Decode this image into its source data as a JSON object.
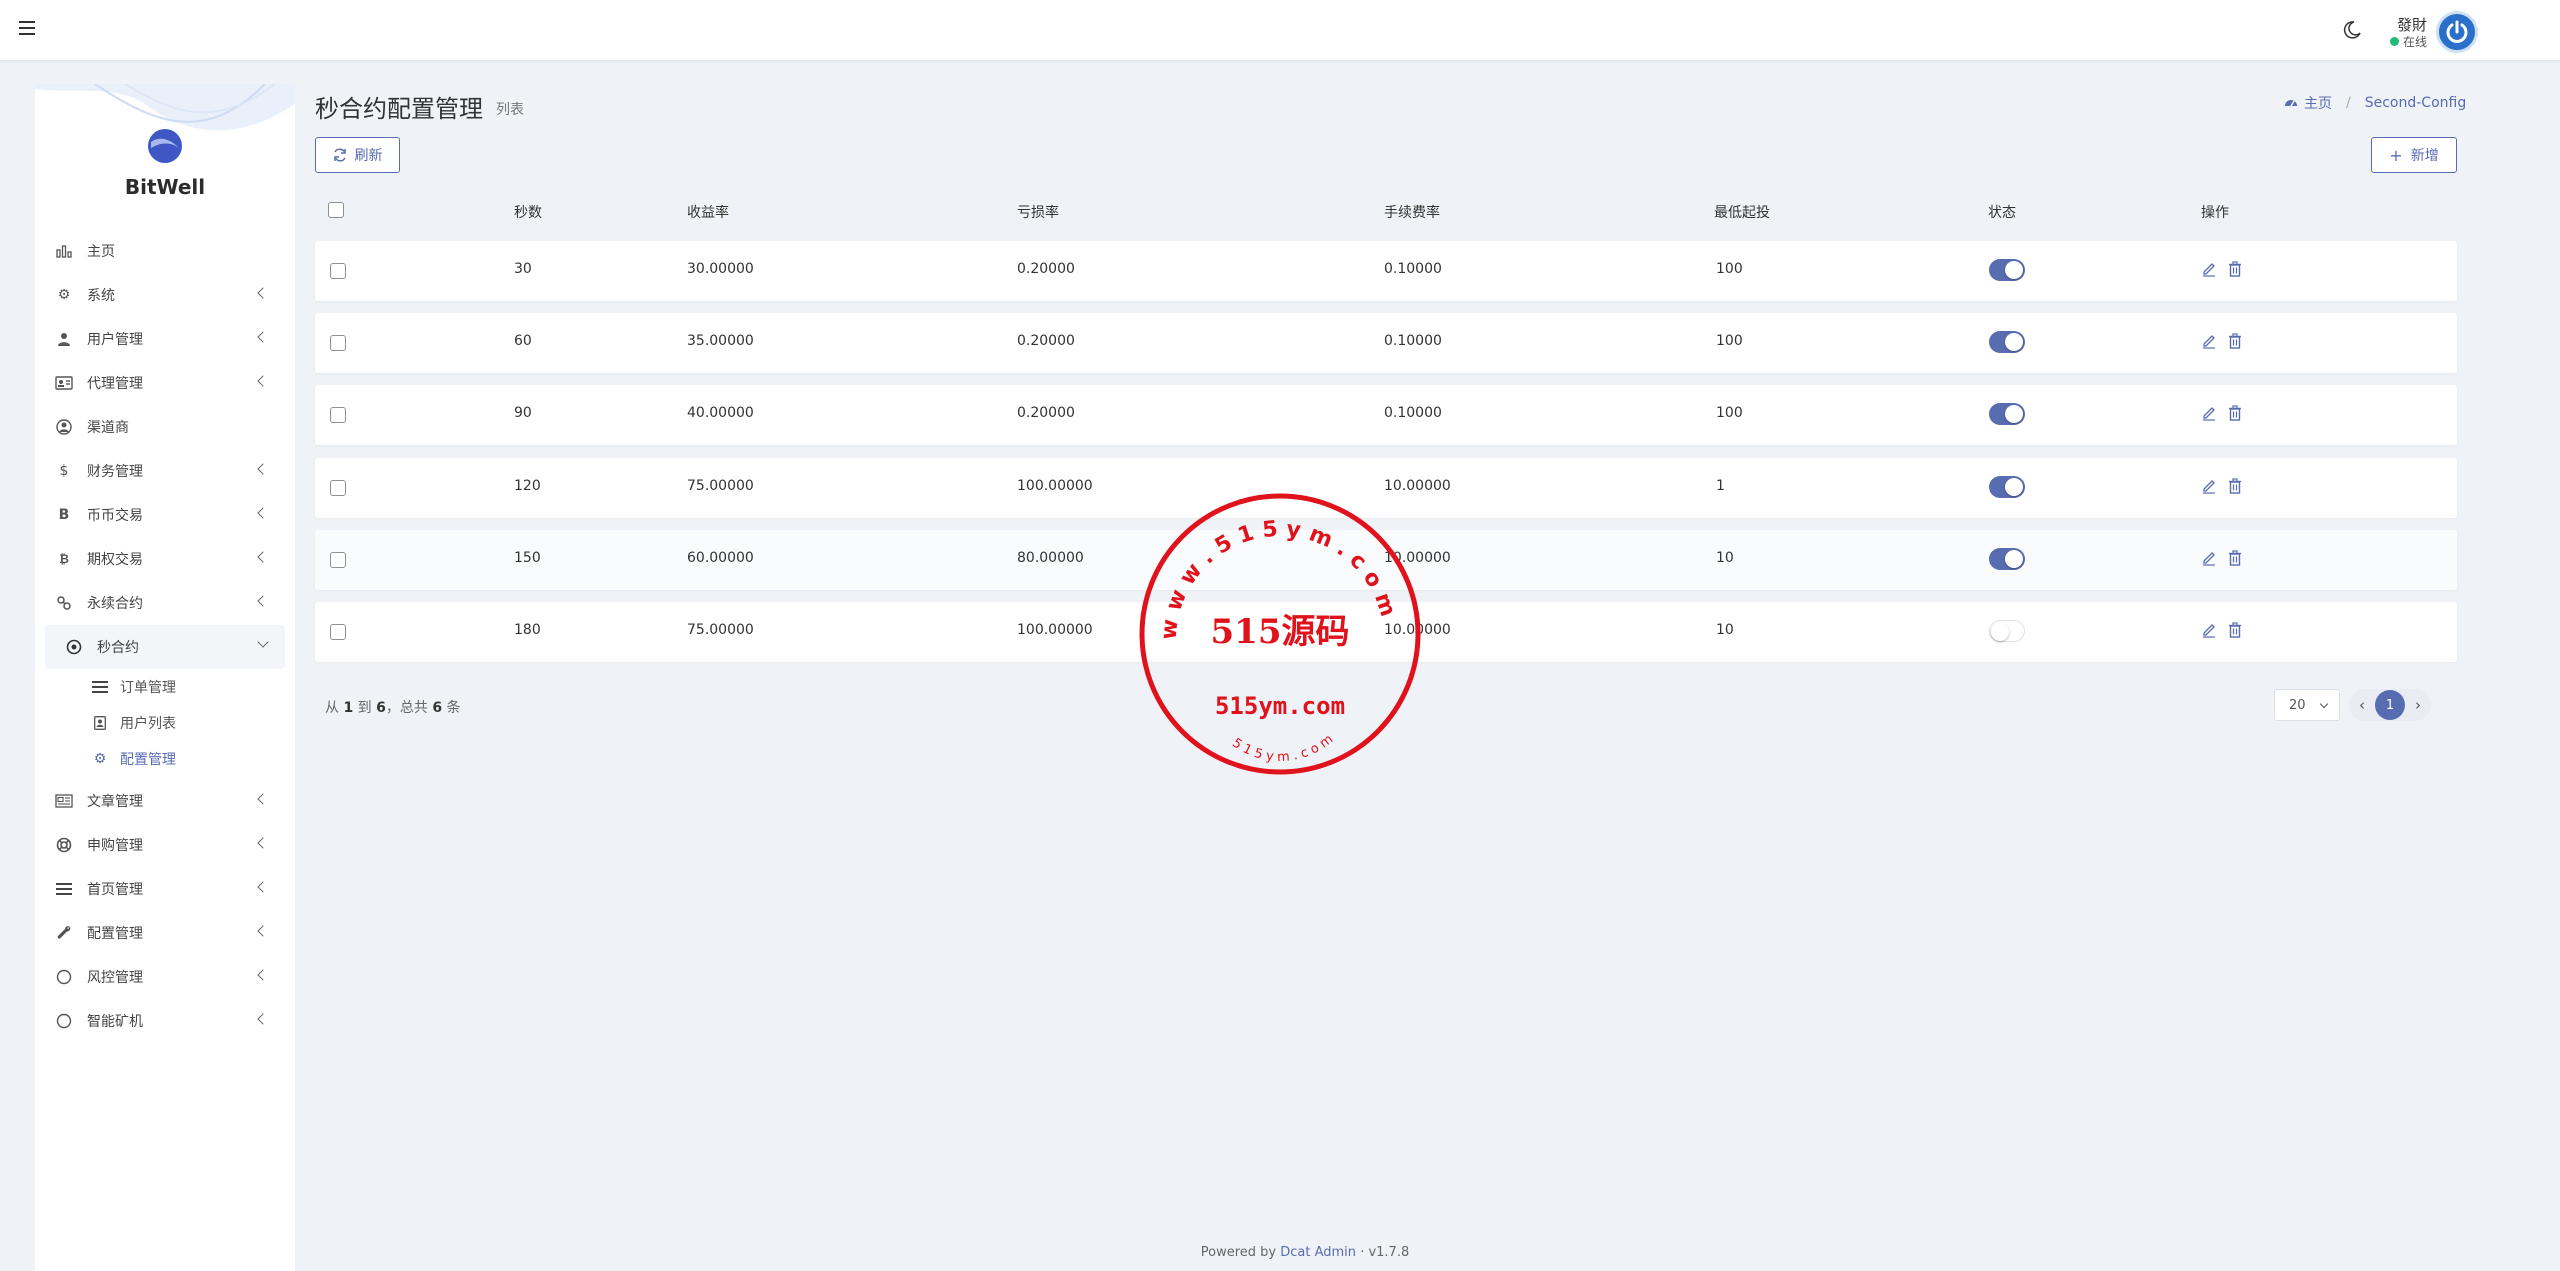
{
  "user": {
    "name": "發財",
    "status": "在线"
  },
  "brand": "BitWell",
  "sidebar": {
    "items": [
      {
        "label": "主页",
        "icon": "bar-chart-icon",
        "chevron": false
      },
      {
        "label": "系统",
        "icon": "gear-icon",
        "chevron": true
      },
      {
        "label": "用户管理",
        "icon": "user-icon",
        "chevron": true
      },
      {
        "label": "代理管理",
        "icon": "id-card-icon",
        "chevron": true
      },
      {
        "label": "渠道商",
        "icon": "user-circle-icon",
        "chevron": false
      },
      {
        "label": "财务管理",
        "icon": "dollar-icon",
        "chevron": true
      },
      {
        "label": "币币交易",
        "icon": "bitcoin-icon",
        "chevron": true
      },
      {
        "label": "期权交易",
        "icon": "bitcoin-coin-icon",
        "chevron": true
      },
      {
        "label": "永续合约",
        "icon": "link-icon",
        "chevron": true
      },
      {
        "label": "秒合约",
        "icon": "dot-circle-icon",
        "chevron": true,
        "open": true
      },
      {
        "label": "文章管理",
        "icon": "newspaper-icon",
        "chevron": true
      },
      {
        "label": "申购管理",
        "icon": "lifebuoy-icon",
        "chevron": true
      },
      {
        "label": "首页管理",
        "icon": "list-icon",
        "chevron": true
      },
      {
        "label": "配置管理",
        "icon": "wrench-icon",
        "chevron": true
      },
      {
        "label": "风控管理",
        "icon": "circle-icon",
        "chevron": true
      },
      {
        "label": "智能矿机",
        "icon": "circle-icon",
        "chevron": true
      }
    ],
    "subitems": [
      {
        "label": "订单管理",
        "icon": "list-icon"
      },
      {
        "label": "用户列表",
        "icon": "contact-icon"
      },
      {
        "label": "配置管理",
        "icon": "gear-icon",
        "active": true
      }
    ]
  },
  "page": {
    "title": "秒合约配置管理",
    "subtitle": "列表"
  },
  "breadcrumb": {
    "home": "主页",
    "current": "Second-Config"
  },
  "toolbar": {
    "refresh_label": "刷新",
    "new_label": "新增"
  },
  "table": {
    "columns": [
      "秒数",
      "收益率",
      "亏损率",
      "手续费率",
      "最低起投",
      "状态",
      "操作"
    ],
    "rows": [
      {
        "seconds": "30",
        "profit": "30.00000",
        "loss": "0.20000",
        "fee": "0.10000",
        "min": "100",
        "status": true
      },
      {
        "seconds": "60",
        "profit": "35.00000",
        "loss": "0.20000",
        "fee": "0.10000",
        "min": "100",
        "status": true
      },
      {
        "seconds": "90",
        "profit": "40.00000",
        "loss": "0.20000",
        "fee": "0.10000",
        "min": "100",
        "status": true
      },
      {
        "seconds": "120",
        "profit": "75.00000",
        "loss": "100.00000",
        "fee": "10.00000",
        "min": "1",
        "status": true
      },
      {
        "seconds": "150",
        "profit": "60.00000",
        "loss": "80.00000",
        "fee": "10.00000",
        "min": "10",
        "status": true
      },
      {
        "seconds": "180",
        "profit": "75.00000",
        "loss": "100.00000",
        "fee": "10.00000",
        "min": "10",
        "status": false
      }
    ]
  },
  "summary": {
    "prefix": "从",
    "from": "1",
    "to_word": "到",
    "to": "6",
    "total_word": "，总共",
    "total": "6",
    "suffix": "条"
  },
  "pagination": {
    "per_page": "20",
    "current": "1",
    "prev": "‹",
    "next": "›"
  },
  "footer": {
    "prefix": "Powered by",
    "link": "Dcat Admin",
    "version": "· v1.7.8"
  },
  "watermark": {
    "main": "515源码",
    "url": "515ym.com",
    "ring_top": "w w w . 5 1 5 y m . c o m",
    "ring_bottom": "5 1 5 y m . c o m"
  },
  "colors": {
    "accent": "#586cb1",
    "online": "#21b978",
    "stamp": "#e0121b"
  }
}
